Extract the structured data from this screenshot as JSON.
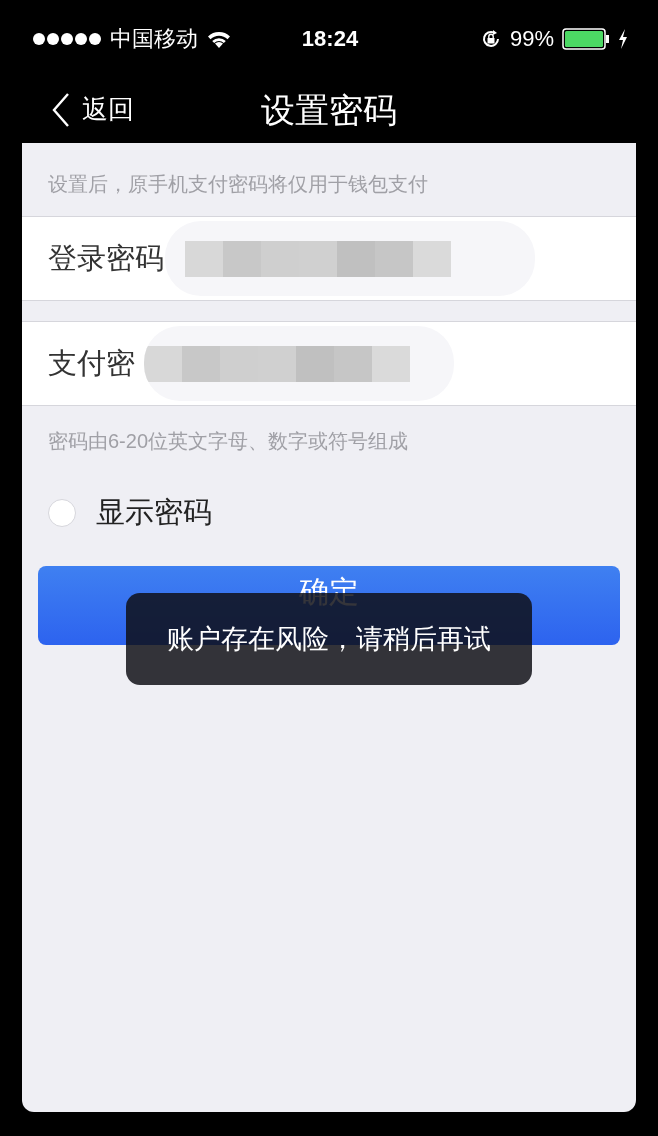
{
  "status_bar": {
    "carrier": "中国移动",
    "time": "18:24",
    "battery_percent": "99%",
    "charging": true
  },
  "nav": {
    "back": "返回",
    "title": "设置密码"
  },
  "notice": "设置后，原手机支付密码将仅用于钱包支付",
  "fields": [
    {
      "label": "登录密码"
    },
    {
      "label": "支付密"
    }
  ],
  "hint": "密码由6-20位英文字母、数字或符号组成",
  "show_password": {
    "label": "显示密码",
    "checked": false
  },
  "confirm_button": "确定",
  "toast": "账户存在风险，请稍后再试"
}
